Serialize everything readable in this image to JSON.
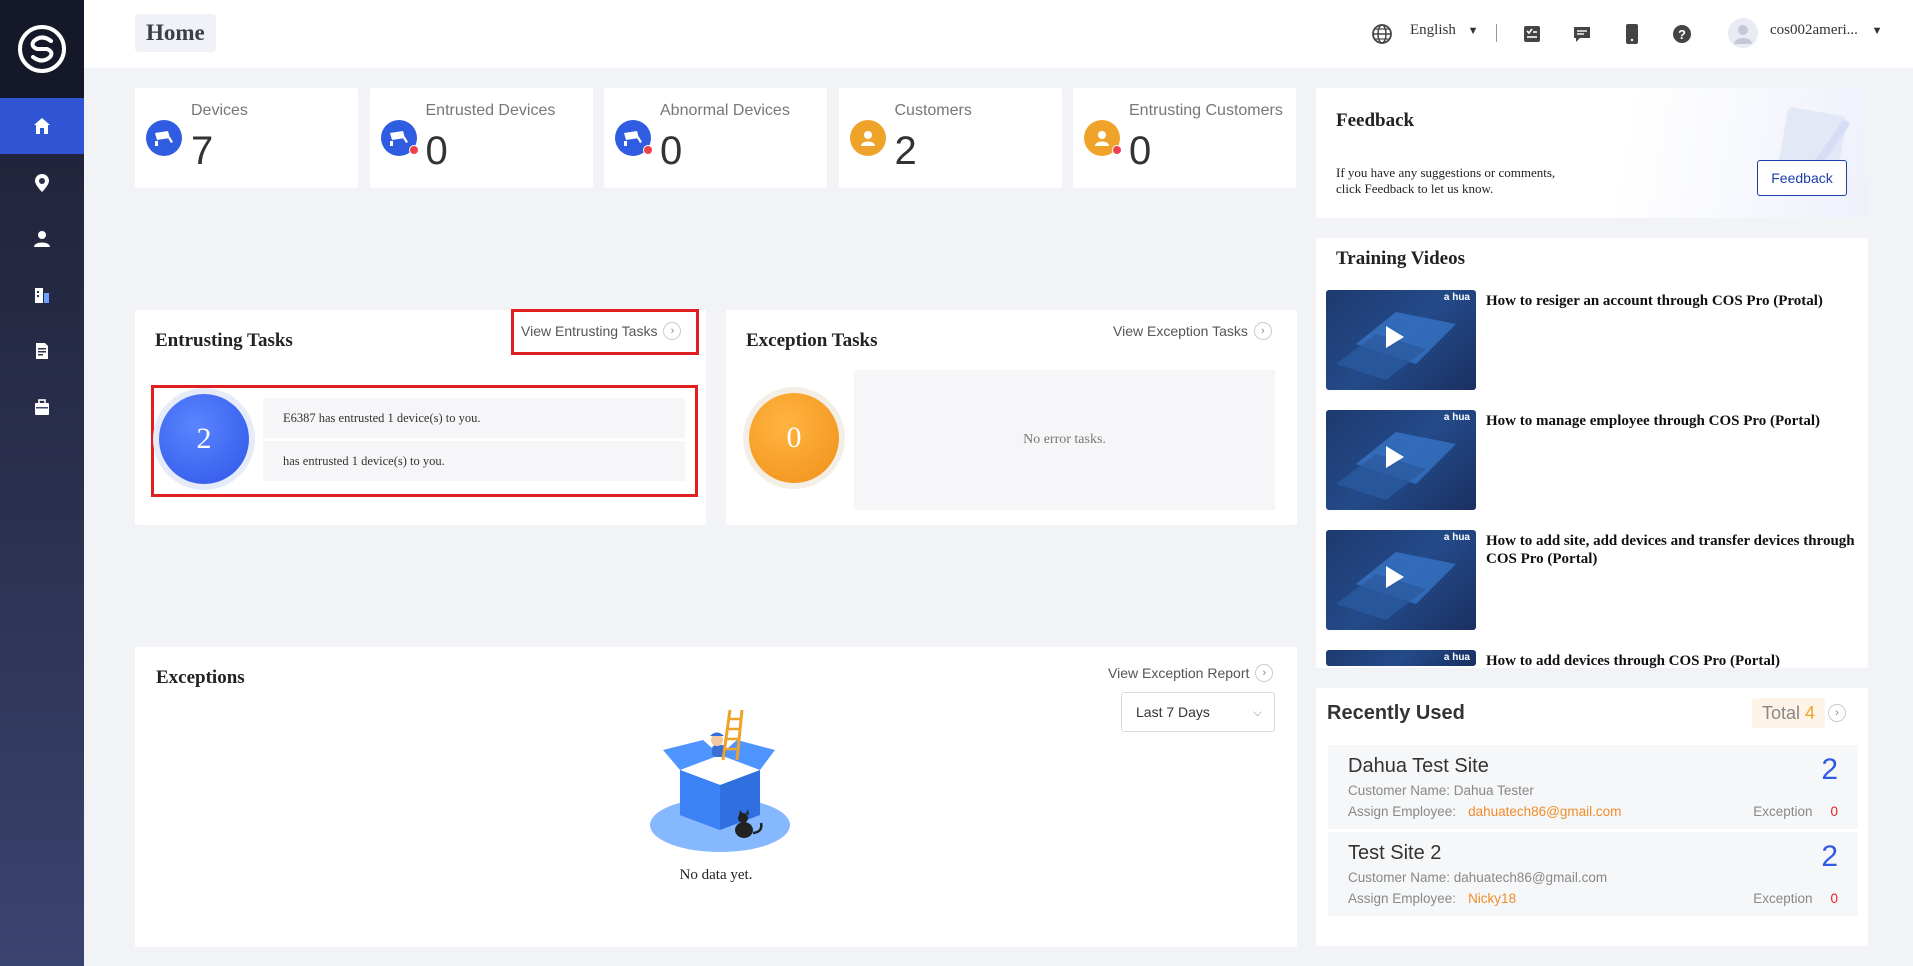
{
  "header": {
    "title": "Home",
    "language": "English",
    "user": "cos002ameri..."
  },
  "stats": [
    {
      "label": "Devices",
      "value": "7",
      "icon": "camera-icon",
      "color": "#2f5ce0",
      "alert": false
    },
    {
      "label": "Entrusted Devices",
      "value": "0",
      "icon": "camera-icon",
      "color": "#2f5ce0",
      "alert": true
    },
    {
      "label": "Abnormal Devices",
      "value": "0",
      "icon": "camera-icon",
      "color": "#2f5ce0",
      "alert": true
    },
    {
      "label": "Customers",
      "value": "2",
      "icon": "person-icon",
      "color": "#f0a32a",
      "alert": false
    },
    {
      "label": "Entrusting Customers",
      "value": "0",
      "icon": "person-icon",
      "color": "#f0a32a",
      "alert": true
    }
  ],
  "entrusting": {
    "title": "Entrusting Tasks",
    "link": "View Entrusting Tasks",
    "count": "2",
    "items": [
      "E6387 has entrusted 1 device(s) to you.",
      "has entrusted 1 device(s) to you."
    ]
  },
  "exception_tasks": {
    "title": "Exception Tasks",
    "link": "View Exception Tasks",
    "count": "0",
    "empty": "No error tasks."
  },
  "exceptions": {
    "title": "Exceptions",
    "link": "View Exception Report",
    "range": "Last 7 Days",
    "empty": "No data yet."
  },
  "feedback": {
    "title": "Feedback",
    "text1": "If you have any suggestions or comments,",
    "text2": "click Feedback to let us know.",
    "button": "Feedback"
  },
  "training": {
    "title": "Training Videos",
    "videos": [
      {
        "title": "How to resiger an account through COS Pro (Protal)"
      },
      {
        "title": "How to manage employee through COS Pro (Portal)"
      },
      {
        "title": "How to add site, add devices and transfer devices through COS Pro (Portal)"
      },
      {
        "title": "How to add devices through COS Pro (Portal)"
      }
    ],
    "brand": "a hua"
  },
  "recent": {
    "title": "Recently Used",
    "total_label": "Total",
    "total": "4",
    "items": [
      {
        "name": "Dahua Test Site",
        "count": "2",
        "customer": "Customer Name: Dahua Tester",
        "assign_label": "Assign Employee:",
        "assign": "dahuatech86@gmail.com",
        "exc_label": "Exception",
        "exc": "0"
      },
      {
        "name": "Test Site 2",
        "count": "2",
        "customer": "Customer Name: dahuatech86@gmail.com",
        "assign_label": "Assign Employee:",
        "assign": "Nicky18",
        "exc_label": "Exception",
        "exc": "0"
      }
    ]
  },
  "colors": {
    "accent": "#2f5ce0",
    "orange": "#f0a32a",
    "highlight": "#e02020"
  }
}
